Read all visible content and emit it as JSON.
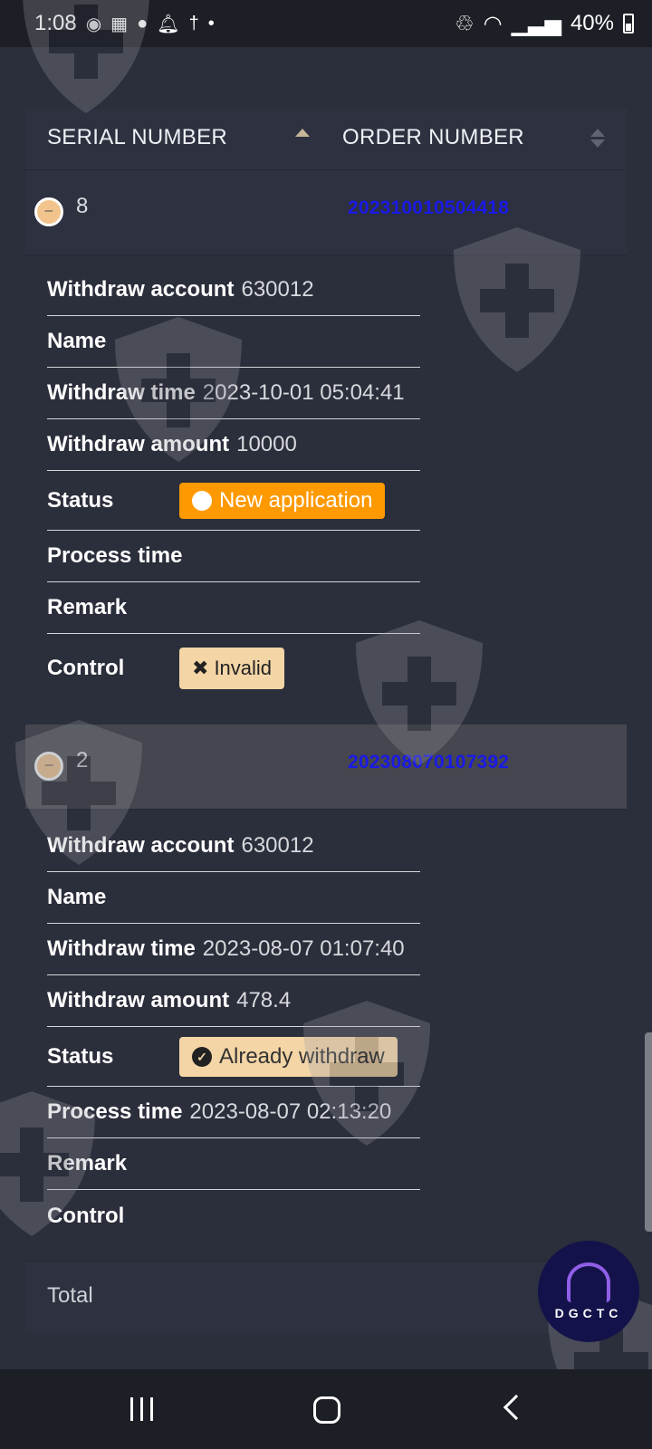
{
  "status_bar": {
    "time": "1:08",
    "battery": "40%"
  },
  "table": {
    "headers": {
      "serial": "SERIAL NUMBER",
      "order": "ORDER NUMBER"
    },
    "rows": [
      {
        "serial": "8",
        "order": "202310010504418",
        "details": {
          "account_label": "Withdraw account",
          "account": "630012",
          "name_label": "Name",
          "name": "",
          "time_label": "Withdraw time",
          "time": "2023-10-01 05:04:41",
          "amount_label": "Withdraw amount",
          "amount": "10000",
          "status_label": "Status",
          "status": "New application",
          "process_label": "Process time",
          "process_time": "",
          "remark_label": "Remark",
          "remark": "",
          "control_label": "Control",
          "control_button": "Invalid"
        }
      },
      {
        "serial": "2",
        "order": "202308070107392",
        "details": {
          "account_label": "Withdraw account",
          "account": "630012",
          "name_label": "Name",
          "name": "",
          "time_label": "Withdraw time",
          "time": "2023-08-07 01:07:40",
          "amount_label": "Withdraw amount",
          "amount": "478.4",
          "status_label": "Status",
          "status": "Already withdraw",
          "process_label": "Process time",
          "process_time": "2023-08-07 02:13:20",
          "remark_label": "Remark",
          "remark": "",
          "control_label": "Control"
        }
      }
    ],
    "total_label": "Total"
  },
  "logo": {
    "text": "DGCTC"
  },
  "colors": {
    "background": "#2b2e3b",
    "status_new": "#ff9900",
    "status_done": "#f4d5a6",
    "order_link": "#1a1ae6"
  },
  "icons": [
    "minus-icon",
    "close-icon",
    "check-circle-icon",
    "sort-asc-icon",
    "sort-icon",
    "watermark-shield-icon"
  ]
}
